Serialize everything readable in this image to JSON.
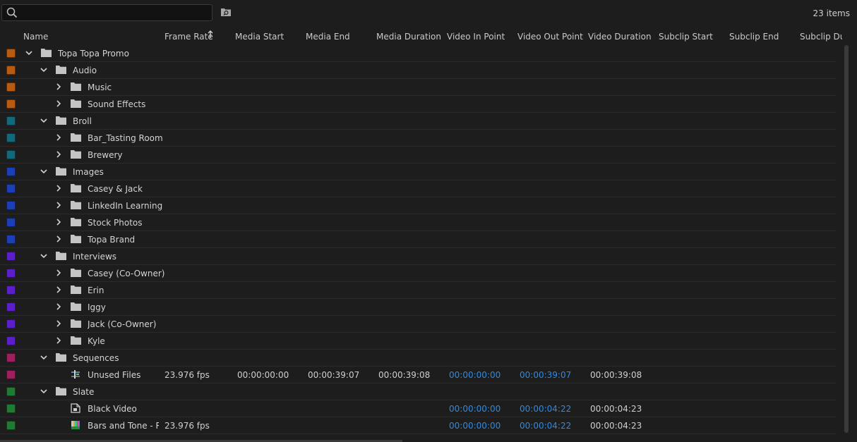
{
  "search": {
    "value": "",
    "placeholder": ""
  },
  "item_count": "23 items",
  "columns": [
    "Name",
    "Frame Rate",
    "Media Start",
    "Media End",
    "Media Duration",
    "Video In Point",
    "Video Out Point",
    "Video Duration",
    "Subclip Start",
    "Subclip End",
    "Subclip Dura"
  ],
  "rows": [
    {
      "name": "Topa Topa Promo",
      "color": "#b85a10",
      "level": 0,
      "expanded": true,
      "type": "bin-icon"
    },
    {
      "name": "Audio",
      "color": "#b85a10",
      "level": 1,
      "expanded": true,
      "type": "bin-icon"
    },
    {
      "name": "Music",
      "color": "#b85a10",
      "level": 2,
      "expanded": false,
      "type": "bin-icon"
    },
    {
      "name": "Sound Effects",
      "color": "#b85a10",
      "level": 2,
      "expanded": false,
      "type": "bin-icon"
    },
    {
      "name": "Broll",
      "color": "#126a78",
      "level": 1,
      "expanded": true,
      "type": "bin-icon"
    },
    {
      "name": "Bar_Tasting Room",
      "color": "#126a78",
      "level": 2,
      "expanded": false,
      "type": "bin-icon"
    },
    {
      "name": "Brewery",
      "color": "#126a78",
      "level": 2,
      "expanded": false,
      "type": "bin-icon"
    },
    {
      "name": "Images",
      "color": "#1d3fb5",
      "level": 1,
      "expanded": true,
      "type": "bin-icon"
    },
    {
      "name": "Casey & Jack",
      "color": "#1d3fb5",
      "level": 2,
      "expanded": false,
      "type": "bin-icon"
    },
    {
      "name": "LinkedIn Learning",
      "color": "#1d3fb5",
      "level": 2,
      "expanded": false,
      "type": "bin-icon"
    },
    {
      "name": "Stock Photos",
      "color": "#1d3fb5",
      "level": 2,
      "expanded": false,
      "type": "bin-icon"
    },
    {
      "name": "Topa Brand",
      "color": "#1d3fb5",
      "level": 2,
      "expanded": false,
      "type": "bin-icon"
    },
    {
      "name": "Interviews",
      "color": "#5b1fc8",
      "level": 1,
      "expanded": true,
      "type": "bin-icon"
    },
    {
      "name": "Casey (Co-Owner)",
      "color": "#5b1fc8",
      "level": 2,
      "expanded": false,
      "type": "bin-icon"
    },
    {
      "name": "Erin",
      "color": "#5b1fc8",
      "level": 2,
      "expanded": false,
      "type": "bin-icon"
    },
    {
      "name": "Iggy",
      "color": "#5b1fc8",
      "level": 2,
      "expanded": false,
      "type": "bin-icon"
    },
    {
      "name": "Jack (Co-Owner)",
      "color": "#5b1fc8",
      "level": 2,
      "expanded": false,
      "type": "bin-icon"
    },
    {
      "name": "Kyle",
      "color": "#5b1fc8",
      "level": 2,
      "expanded": false,
      "type": "bin-icon"
    },
    {
      "name": "Sequences",
      "color": "#9c1f5e",
      "level": 1,
      "expanded": true,
      "type": "bin-icon"
    },
    {
      "name": "Unused Files",
      "color": "#9c1f5e",
      "level": 2,
      "type": "sequence-icon",
      "frame_rate": "23.976 fps",
      "media_start": "00:00:00:00",
      "media_end": "00:00:39:07",
      "media_duration": "00:00:39:08",
      "video_in": "00:00:00:00",
      "video_out": "00:00:39:07",
      "video_duration": "00:00:39:08"
    },
    {
      "name": "Slate",
      "color": "#1f7a34",
      "level": 1,
      "expanded": true,
      "type": "bin-icon"
    },
    {
      "name": "Black Video",
      "color": "#1f7a34",
      "level": 2,
      "type": "synthetic-clip-icon",
      "video_in": "00:00:00:00",
      "video_out": "00:00:04:22",
      "video_duration": "00:00:04:23"
    },
    {
      "name": "Bars and Tone - Rec",
      "color": "#1f7a34",
      "level": 2,
      "type": "bars-and-tone-icon",
      "frame_rate": "23.976 fps",
      "video_in": "00:00:00:00",
      "video_out": "00:00:04:22",
      "video_duration": "00:00:04:23"
    }
  ]
}
